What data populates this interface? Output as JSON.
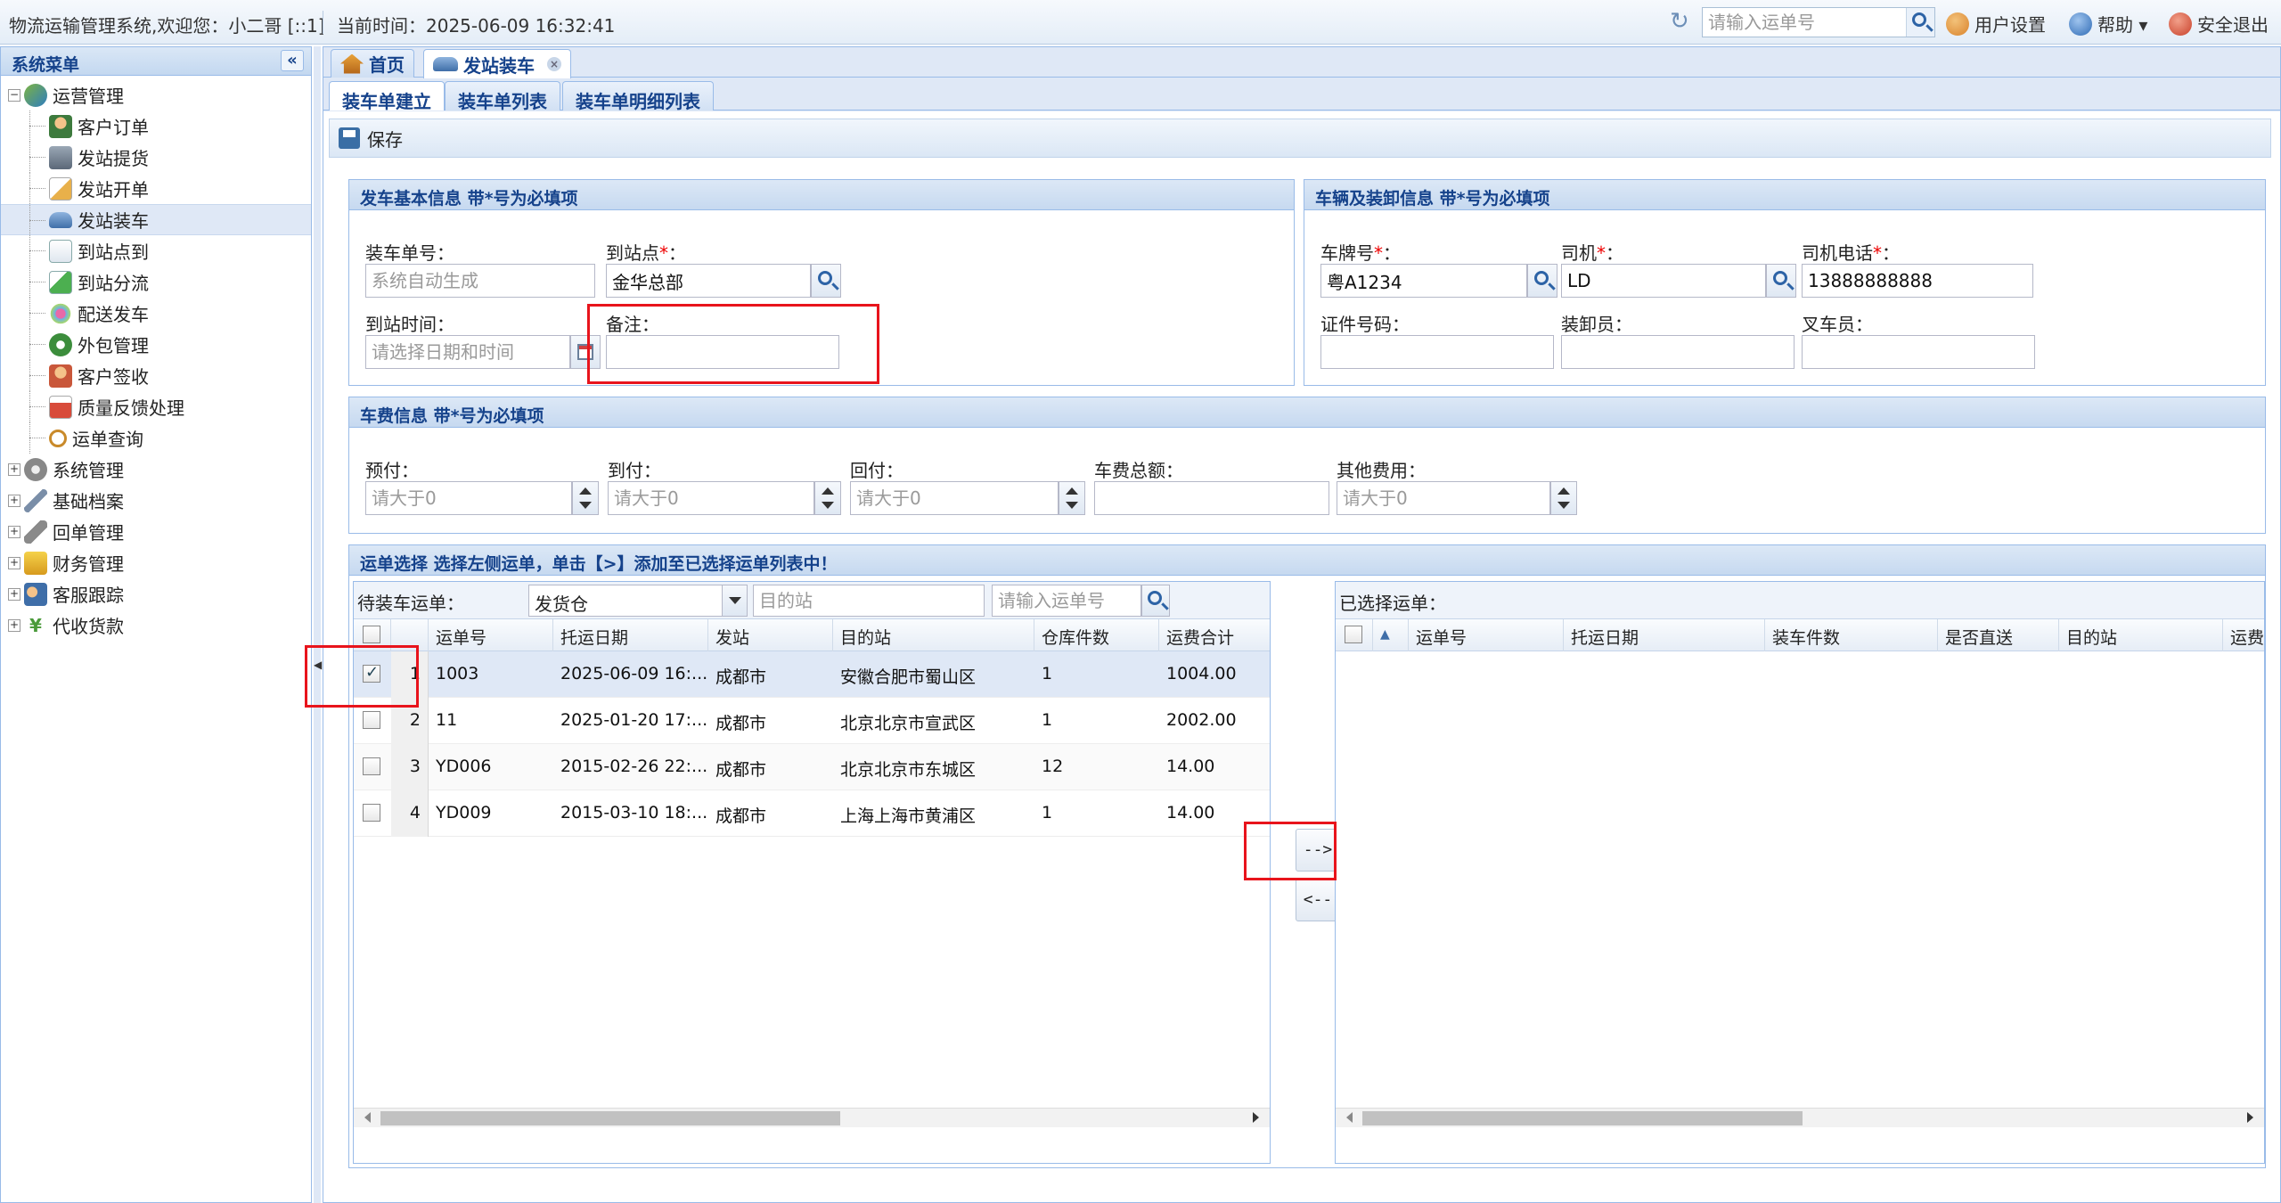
{
  "topbar": {
    "system_info": "物流运输管理系统,欢迎您：小二哥 [::1]",
    "current_time": "当前时间：2025-06-09 16:32:41",
    "search_placeholder": "请输入运单号",
    "user_settings": "用户设置",
    "help": "帮助 ▾",
    "logout": "安全退出"
  },
  "sidebar": {
    "title": "系统菜单",
    "groups": [
      {
        "label": "运营管理",
        "expanded": true,
        "items": [
          {
            "label": "客户订单"
          },
          {
            "label": "发站提货"
          },
          {
            "label": "发站开单"
          },
          {
            "label": "发站装车",
            "selected": true
          },
          {
            "label": "到站点到"
          },
          {
            "label": "到站分流"
          },
          {
            "label": "配送发车"
          },
          {
            "label": "外包管理"
          },
          {
            "label": "客户签收"
          },
          {
            "label": "质量反馈处理"
          },
          {
            "label": "运单查询"
          }
        ]
      },
      {
        "label": "系统管理"
      },
      {
        "label": "基础档案"
      },
      {
        "label": "回单管理"
      },
      {
        "label": "财务管理"
      },
      {
        "label": "客服跟踪"
      },
      {
        "label": "代收货款"
      }
    ]
  },
  "tabs": [
    {
      "label": "首页"
    },
    {
      "label": "发站装车",
      "active": true
    }
  ],
  "subtabs": [
    {
      "label": "装车单建立",
      "active": true
    },
    {
      "label": "装车单列表"
    },
    {
      "label": "装车单明细列表"
    }
  ],
  "toolbar": {
    "save_label": "保存"
  },
  "dispatch_panel": {
    "title": "发车基本信息 带*号为必填项",
    "load_no_label": "装车单号：",
    "load_no_placeholder": "系统自动生成",
    "arrival_station_label": "到站点",
    "arrival_station_value": "金华总部",
    "arrival_time_label": "到站时间：",
    "arrival_time_placeholder": "请选择日期和时间",
    "remark_label": "备注："
  },
  "vehicle_panel": {
    "title": "车辆及装卸信息 带*号为必填项",
    "plate_label": "车牌号",
    "plate_value": "粤A1234",
    "driver_label": "司机",
    "driver_value": "LD",
    "phone_label": "司机电话",
    "phone_value": "13888888888",
    "cert_label": "证件号码：",
    "loader_label": "装卸员：",
    "forklift_label": "叉车员："
  },
  "fee_panel": {
    "title": "车费信息 带*号为必填项",
    "prepaid_label": "预付：",
    "topay_label": "到付：",
    "return_label": "回付：",
    "total_label": "车费总额：",
    "other_label": "其他费用：",
    "placeholder": "请大于0"
  },
  "waybill_panel": {
    "title": "运单选择 选择左侧运单，单击【>】添加至已选择运单列表中！",
    "pending_label": "待装车运单：",
    "warehouse_value": "发货仓",
    "dest_placeholder": "目的站",
    "waybill_placeholder": "请输入运单号",
    "selected_label": "已选择运单：",
    "move_right": "-->",
    "move_left": "<--"
  },
  "left_grid": {
    "columns": [
      "运单号",
      "托运日期",
      "发站",
      "目的站",
      "仓库件数",
      "运费合计"
    ],
    "rows": [
      {
        "num": "1",
        "checked": true,
        "cells": [
          "1003",
          "2025-06-09 16:...",
          "成都市",
          "安徽合肥市蜀山区",
          "1",
          "1004.00"
        ]
      },
      {
        "num": "2",
        "checked": false,
        "cells": [
          "11",
          "2025-01-20 17:...",
          "成都市",
          "北京北京市宣武区",
          "1",
          "2002.00"
        ]
      },
      {
        "num": "3",
        "checked": false,
        "cells": [
          "YD006",
          "2015-02-26 22:...",
          "成都市",
          "北京北京市东城区",
          "12",
          "14.00"
        ]
      },
      {
        "num": "4",
        "checked": false,
        "cells": [
          "YD009",
          "2015-03-10 18:...",
          "成都市",
          "上海上海市黄浦区",
          "1",
          "14.00"
        ]
      }
    ]
  },
  "right_grid": {
    "columns": [
      "运单号",
      "托运日期",
      "装车件数",
      "是否直送",
      "目的站",
      "运费"
    ]
  },
  "colors": {
    "header_blue": "#15428b",
    "border_blue": "#99bbe8",
    "highlight_red": "#e8141c",
    "selected_row": "#dfe8f6"
  }
}
